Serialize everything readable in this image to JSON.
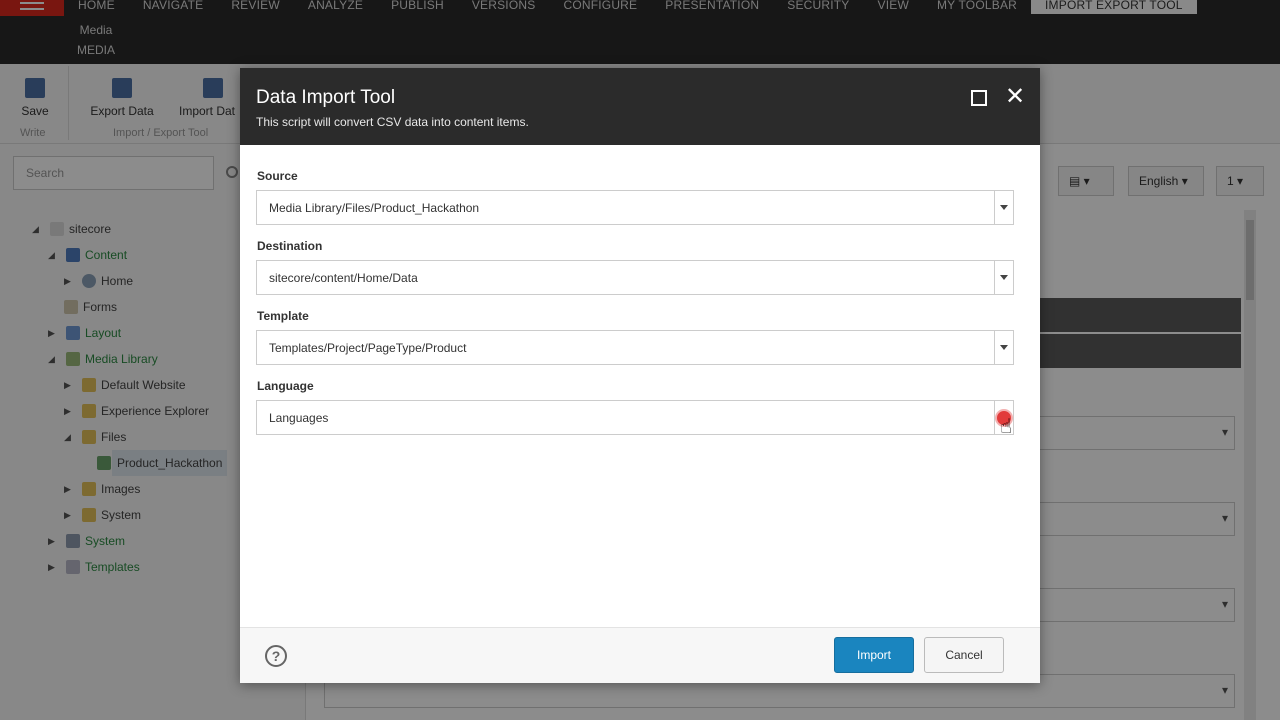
{
  "ribbon": {
    "tabs": [
      "HOME",
      "NAVIGATE",
      "REVIEW",
      "ANALYZE",
      "PUBLISH",
      "VERSIONS",
      "CONFIGURE",
      "PRESENTATION",
      "SECURITY",
      "VIEW",
      "MY TOOLBAR",
      "IMPORT EXPORT TOOL"
    ],
    "active_tab": "IMPORT EXPORT TOOL",
    "crumb_line1": "Media",
    "crumb_line2": "MEDIA"
  },
  "toolbar": {
    "save_label": "Save",
    "write_group": "Write",
    "export_label": "Export Data",
    "import_label": "Import Dat",
    "import_export_group": "Import / Export Tool"
  },
  "search": {
    "placeholder": "Search"
  },
  "tree": [
    {
      "label": "sitecore",
      "link": false
    },
    {
      "label": "Content",
      "link": true
    },
    {
      "label": "Home",
      "link": false
    },
    {
      "label": "Forms",
      "link": false
    },
    {
      "label": "Layout",
      "link": true
    },
    {
      "label": "Media Library",
      "link": true
    },
    {
      "label": "Default Website",
      "link": false
    },
    {
      "label": "Experience Explorer",
      "link": false
    },
    {
      "label": "Files",
      "link": false
    },
    {
      "label": "Product_Hackathon",
      "link": false
    },
    {
      "label": "Images",
      "link": false
    },
    {
      "label": "System",
      "link": false
    },
    {
      "label": "System",
      "link": true
    },
    {
      "label": "Templates",
      "link": true
    }
  ],
  "right_pane": {
    "language": "English",
    "version": "1"
  },
  "dialog": {
    "title": "Data Import Tool",
    "subtitle": "This script will convert CSV data into content items.",
    "fields": [
      {
        "label": "Source",
        "value": "Media Library/Files/Product_Hackathon"
      },
      {
        "label": "Destination",
        "value": "sitecore/content/Home/Data"
      },
      {
        "label": "Template",
        "value": "Templates/Project/PageType/Product"
      },
      {
        "label": "Language",
        "value": "Languages"
      }
    ],
    "help": "?",
    "import_label": "Import",
    "cancel_label": "Cancel"
  },
  "colors": {
    "dialog_header": "#2b2b2b",
    "import_button": "#1a85bf",
    "tree_link": "#2c8a43",
    "brand_red": "#dc291e"
  }
}
